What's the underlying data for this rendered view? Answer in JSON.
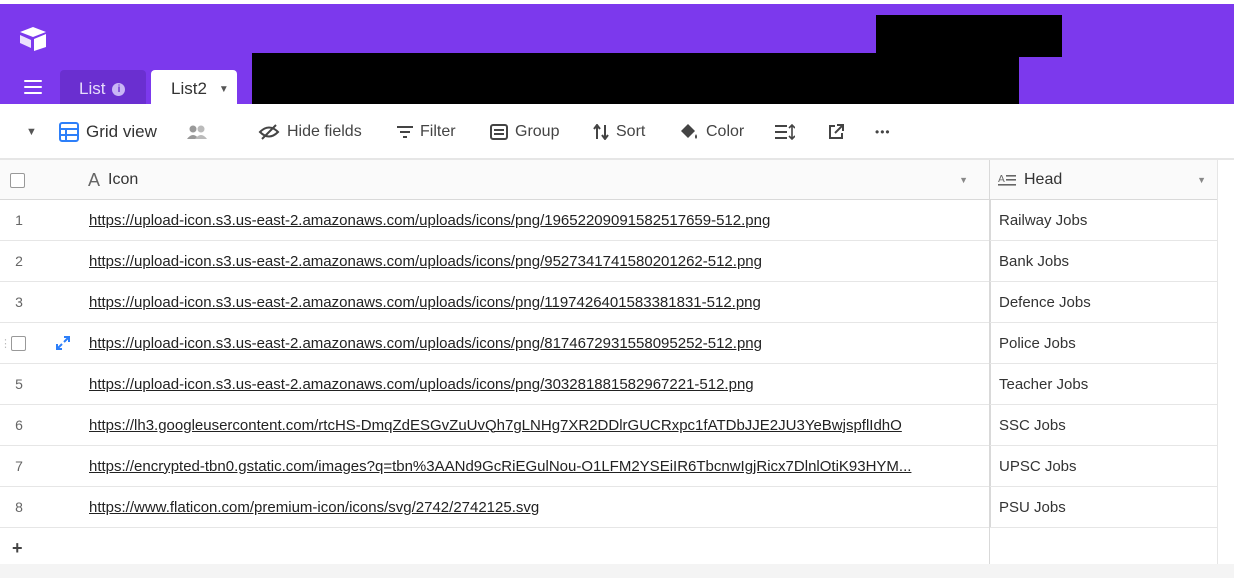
{
  "tabs": [
    {
      "label": "List",
      "active": false
    },
    {
      "label": "List2",
      "active": true
    }
  ],
  "toolbar": {
    "view_name": "Grid view",
    "hide_fields": "Hide fields",
    "filter": "Filter",
    "group": "Group",
    "sort": "Sort",
    "color": "Color",
    "more": "•••"
  },
  "columns": {
    "icon": "Icon",
    "head": "Head"
  },
  "rows": [
    {
      "num": "1",
      "url": "https://upload-icon.s3.us-east-2.amazonaws.com/uploads/icons/png/19652209091582517659-512.png",
      "head": "Railway Jobs"
    },
    {
      "num": "2",
      "url": "https://upload-icon.s3.us-east-2.amazonaws.com/uploads/icons/png/9527341741580201262-512.png",
      "head": "Bank Jobs"
    },
    {
      "num": "3",
      "url": "https://upload-icon.s3.us-east-2.amazonaws.com/uploads/icons/png/1197426401583381831-512.png",
      "head": "Defence Jobs"
    },
    {
      "num": "",
      "url": "https://upload-icon.s3.us-east-2.amazonaws.com/uploads/icons/png/8174672931558095252-512.png",
      "head": "Police Jobs"
    },
    {
      "num": "5",
      "url": "https://upload-icon.s3.us-east-2.amazonaws.com/uploads/icons/png/303281881582967221-512.png",
      "head": "Teacher Jobs"
    },
    {
      "num": "6",
      "url": "https://lh3.googleusercontent.com/rtcHS-DmqZdESGvZuUvQh7gLNHg7XR2DDlrGUCRxpc1fATDbJJE2JU3YeBwjspflIdhO",
      "head": "SSC Jobs"
    },
    {
      "num": "7",
      "url": "https://encrypted-tbn0.gstatic.com/images?q=tbn%3AANd9GcRiEGulNou-O1LFM2YSEiIR6TbcnwIgjRicx7DlnlOtiK93HYM...",
      "head": "UPSC Jobs"
    },
    {
      "num": "8",
      "url": "https://www.flaticon.com/premium-icon/icons/svg/2742/2742125.svg",
      "head": "PSU Jobs"
    }
  ],
  "add_row": "+",
  "colors": {
    "brand": "#7c39ed",
    "tab_inactive": "#6a2fd0",
    "grid_icon": "#2d7ff9"
  }
}
